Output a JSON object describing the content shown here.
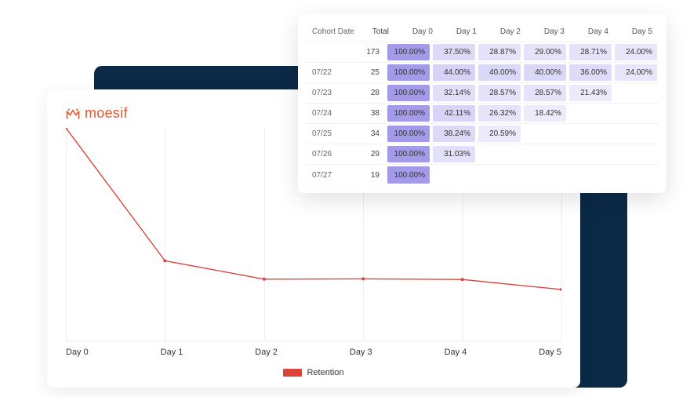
{
  "brand": {
    "name": "moesif"
  },
  "chart_data": {
    "type": "line",
    "title": "",
    "xlabel": "",
    "ylabel": "",
    "series": [
      {
        "name": "Retention",
        "x": [
          "Day 0",
          "Day 1",
          "Day 2",
          "Day 3",
          "Day 4",
          "Day 5"
        ],
        "values": [
          100.0,
          37.5,
          28.87,
          29.0,
          28.71,
          24.0
        ]
      }
    ],
    "ylim": [
      0,
      100
    ],
    "legend": {
      "items": [
        "Retention"
      ]
    },
    "x_ticks": [
      "Day 0",
      "Day 1",
      "Day 2",
      "Day 3",
      "Day 4",
      "Day 5"
    ]
  },
  "table": {
    "headers": [
      "Cohort Date",
      "Total",
      "Day 0",
      "Day 1",
      "Day 2",
      "Day 3",
      "Day 4",
      "Day 5"
    ],
    "rows": [
      {
        "date": "",
        "total": 173,
        "cells": [
          "100.00%",
          "37.50%",
          "28.87%",
          "29.00%",
          "28.71%",
          "24.00%"
        ]
      },
      {
        "date": "07/22",
        "total": 25,
        "cells": [
          "100.00%",
          "44.00%",
          "40.00%",
          "40.00%",
          "36.00%",
          "24.00%"
        ]
      },
      {
        "date": "07/23",
        "total": 28,
        "cells": [
          "100.00%",
          "32.14%",
          "28.57%",
          "28.57%",
          "21.43%"
        ]
      },
      {
        "date": "07/24",
        "total": 38,
        "cells": [
          "100.00%",
          "42.11%",
          "26.32%",
          "18.42%"
        ]
      },
      {
        "date": "07/25",
        "total": 34,
        "cells": [
          "100.00%",
          "38.24%",
          "20.59%"
        ]
      },
      {
        "date": "07/26",
        "total": 29,
        "cells": [
          "100.00%",
          "31.03%"
        ]
      },
      {
        "date": "07/27",
        "total": 19,
        "cells": [
          "100.00%"
        ]
      }
    ]
  },
  "colors": {
    "line": "#d9453a",
    "heat_base": "#9a8fe8"
  }
}
